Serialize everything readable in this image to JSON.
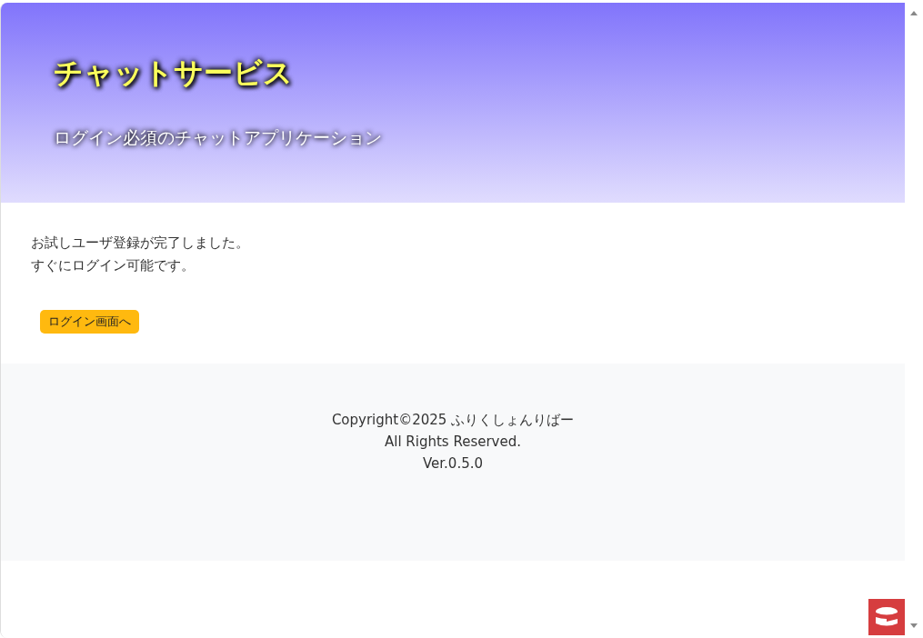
{
  "header": {
    "title": "チャットサービス",
    "subtitle": "ログイン必須のチャットアプリケーション"
  },
  "message": {
    "lines": [
      "お試しユーザ登録が完了しました。",
      "すぐにログイン可能です。"
    ],
    "button": "ログイン画面へ"
  },
  "footer": {
    "lines": [
      "Copyright©2025 ふりくしょんりばー",
      "All Rights Reserved.",
      "Ver.0.5.0"
    ]
  }
}
